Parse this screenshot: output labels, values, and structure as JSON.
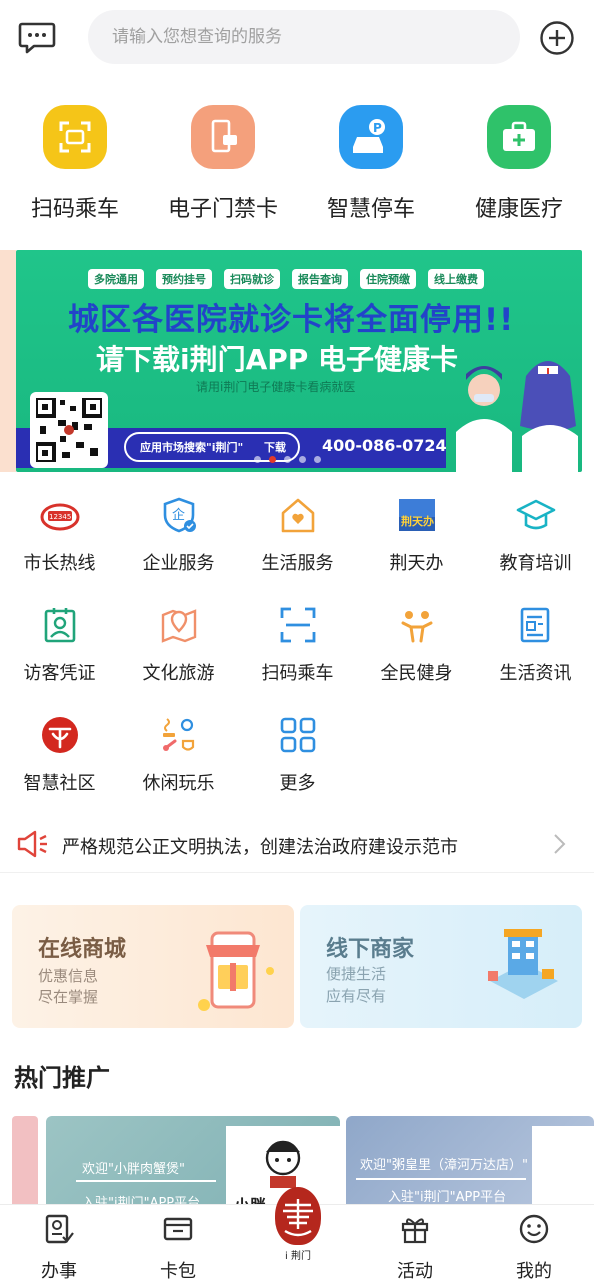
{
  "search": {
    "placeholder": "请输入您想查询的服务"
  },
  "quick_actions": [
    {
      "label": "扫码乘车",
      "icon": "scan-icon",
      "color": "#f5c518"
    },
    {
      "label": "电子门禁卡",
      "icon": "door-card-icon",
      "color": "#f4a07c"
    },
    {
      "label": "智慧停车",
      "icon": "parking-icon",
      "color": "#2b9cf0"
    },
    {
      "label": "健康医疗",
      "icon": "medical-kit-icon",
      "color": "#2fc26a"
    }
  ],
  "banner": {
    "tags": [
      "多院通用",
      "预约挂号",
      "扫码就诊",
      "报告查询",
      "住院预缴",
      "线上缴费"
    ],
    "title": "城区各医院就诊卡将全面停用!!",
    "subtitle": "请下载i荆门APP 电子健康卡",
    "small": "请用i荆门电子健康卡看病就医",
    "search_hint": "应用市场搜索\"i荆门\"",
    "download": "下载",
    "phone": "400-086-0724",
    "pages": 5,
    "active_page": 1
  },
  "services": [
    {
      "label": "市长热线",
      "icon": "hotline-12345-icon"
    },
    {
      "label": "企业服务",
      "icon": "enterprise-shield-icon"
    },
    {
      "label": "生活服务",
      "icon": "home-heart-icon"
    },
    {
      "label": "荆天办",
      "icon": "jingtianban-icon"
    },
    {
      "label": "教育培训",
      "icon": "graduation-cap-icon"
    },
    {
      "label": "访客凭证",
      "icon": "visitor-badge-icon"
    },
    {
      "label": "文化旅游",
      "icon": "map-pin-icon"
    },
    {
      "label": "扫码乘车",
      "icon": "scan-icon"
    },
    {
      "label": "全民健身",
      "icon": "fitness-icon"
    },
    {
      "label": "生活资讯",
      "icon": "news-icon"
    },
    {
      "label": "智慧社区",
      "icon": "community-icon"
    },
    {
      "label": "休闲玩乐",
      "icon": "leisure-icon"
    },
    {
      "label": "更多",
      "icon": "grid-more-icon"
    }
  ],
  "notice": {
    "text": "严格规范公正文明执法，创建法治政府建设示范市"
  },
  "promo": [
    {
      "title": "在线商城",
      "line1": "优惠信息",
      "line2": "尽在掌握"
    },
    {
      "title": "线下商家",
      "line1": "便捷生活",
      "line2": "应有尽有"
    }
  ],
  "hot": {
    "title": "热门推广",
    "cards": [
      {
        "line1": "欢迎\"小胖肉蟹煲\"",
        "line2": "入驻\"i荆门\"APP平台",
        "brand": "小胖"
      },
      {
        "line1": "欢迎\"粥皇里（漳河万达店）\"",
        "line2": "入驻\"i荆门\"APP平台"
      }
    ]
  },
  "tabs": [
    {
      "label": "办事",
      "icon": "affairs-icon"
    },
    {
      "label": "卡包",
      "icon": "wallet-icon"
    },
    {
      "label": "i 荆门",
      "icon": "jingmen-logo-icon"
    },
    {
      "label": "活动",
      "icon": "gift-icon"
    },
    {
      "label": "我的",
      "icon": "smile-icon"
    }
  ]
}
